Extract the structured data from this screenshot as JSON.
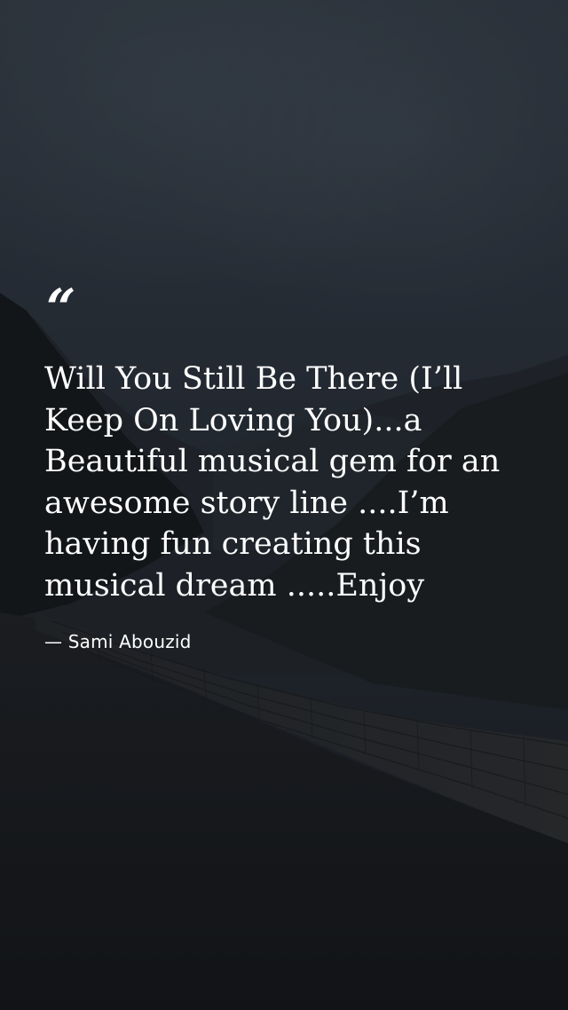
{
  "quote": {
    "mark": "“",
    "text": "Will You Still Be There (I’ll Keep On Loving You)...a Beautiful musical gem for an awesome story line ....I’m having fun creating this musical dream .....Enjoy",
    "author": "— Sami Abouzid"
  },
  "colors": {
    "text": "#ffffff",
    "sky": "#2b3440",
    "ground": "#15171a"
  }
}
